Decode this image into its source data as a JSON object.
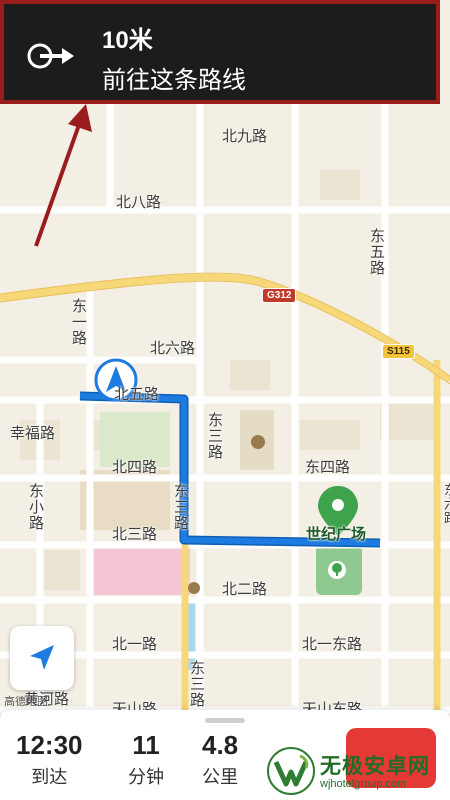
{
  "banner": {
    "distance": "10米",
    "instruction": "前往这条路线"
  },
  "map": {
    "labels": {
      "beijiu": "北九路",
      "beiba": "北八路",
      "beiliu": "北六路",
      "beiwu": "北五路",
      "beisi": "北四路",
      "beisan": "北三路",
      "beier": "北二路",
      "beiyi": "北一路",
      "beiyidong": "北一东路",
      "xingfu": "幸福路",
      "dongsi": "东四路",
      "shiji": "世纪广场",
      "tianshan": "天山路",
      "tianshandong": "天山东路",
      "huanghe": "黄河路"
    },
    "vertical_labels": {
      "dongwu": "东五路",
      "dongyi": "东一路",
      "dongsan": "东三路",
      "dongsan_b": "东三路",
      "dongsan_c": "东三路",
      "dongliu": "东六路",
      "dongxiao": "东小路"
    },
    "badges": {
      "g312": "G312",
      "s115": "S115"
    },
    "provider": "高德地图"
  },
  "bottom": {
    "arrive_time": "12:30",
    "arrive_label": "到达",
    "minutes": "11",
    "minutes_label": "分钟",
    "km": "4.8",
    "km_label": "公里"
  },
  "watermark": {
    "title": "无极安卓网",
    "url": "wjhotelgroup.com"
  },
  "colors": {
    "route": "#1e7be0",
    "banner_bg": "#1c1c1c",
    "highlight_border": "#9b1c1c",
    "park": "#8fc98f",
    "exit_button": "#e53935"
  }
}
